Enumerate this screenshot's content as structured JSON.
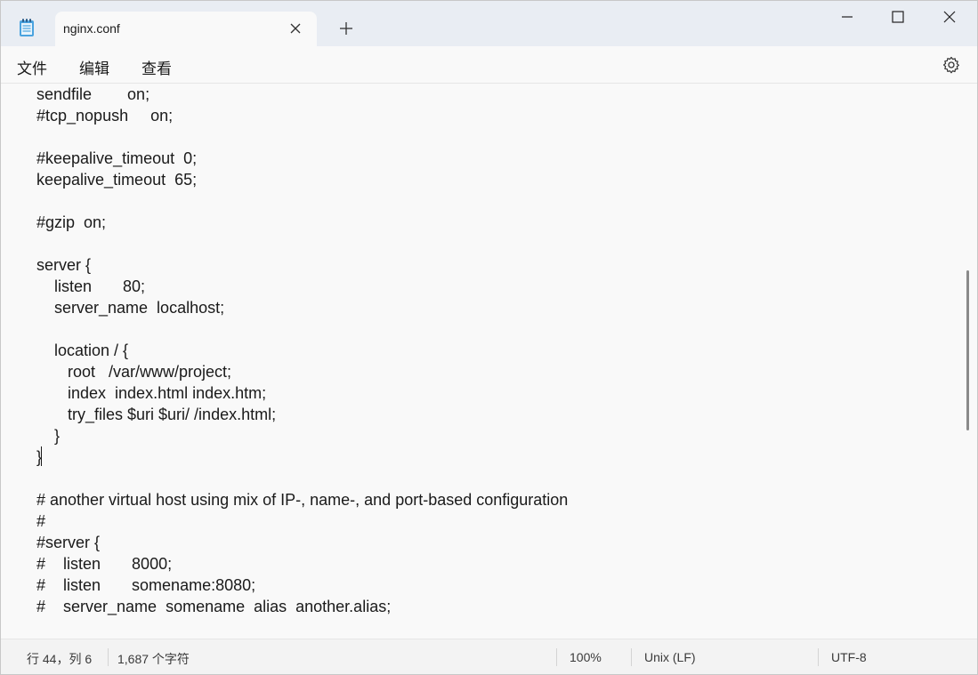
{
  "tab": {
    "title": "nginx.conf"
  },
  "menu": {
    "file": "文件",
    "edit": "编辑",
    "view": "查看"
  },
  "editor": {
    "lines": [
      "sendfile        on;",
      "#tcp_nopush     on;",
      "",
      "#keepalive_timeout  0;",
      "keepalive_timeout  65;",
      "",
      "#gzip  on;",
      "",
      "server {",
      "    listen       80;",
      "    server_name  localhost;",
      "",
      "    location / {",
      "       root   /var/www/project;",
      "       index  index.html index.htm;",
      "       try_files $uri $uri/ /index.html;",
      "    }",
      "}",
      "",
      "# another virtual host using mix of IP-, name-, and port-based configuration",
      "#",
      "#server {",
      "#    listen       8000;",
      "#    listen       somename:8080;",
      "#    server_name  somename  alias  another.alias;"
    ]
  },
  "status": {
    "position": "行 44，列 6",
    "char_count": "1,687 个字符",
    "zoom": "100%",
    "line_ending": "Unix (LF)",
    "encoding": "UTF-8"
  }
}
